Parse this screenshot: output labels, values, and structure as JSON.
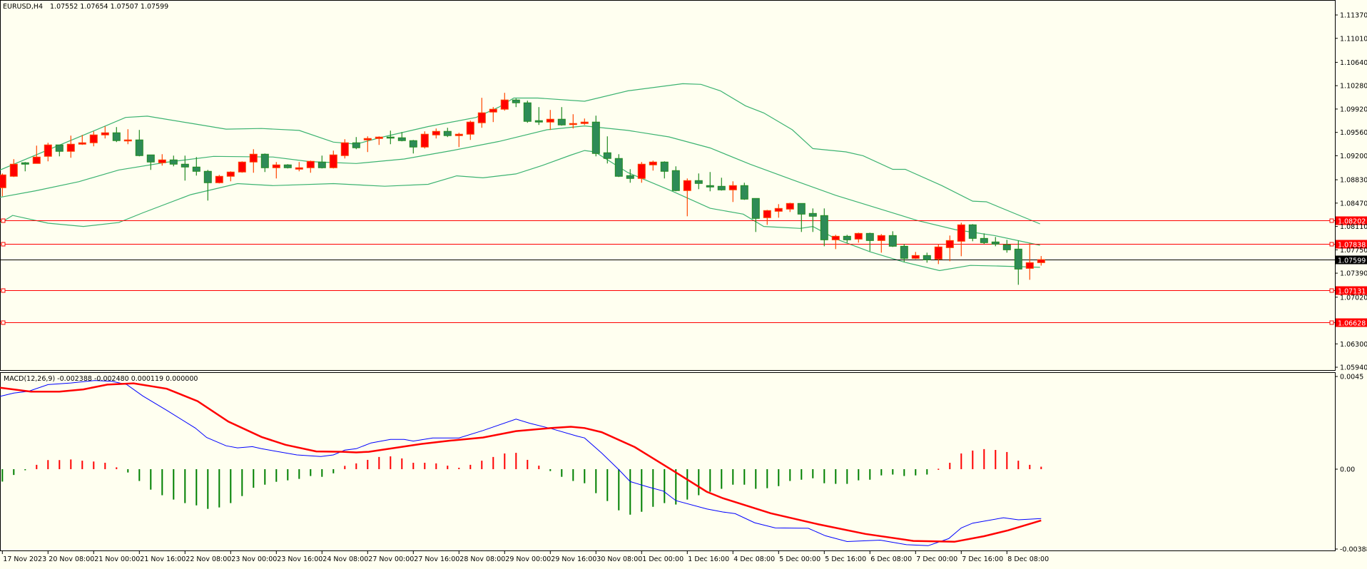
{
  "header": {
    "symbol_label": "EURUSD,H4",
    "ohlc_label": "1.07552 1.07654 1.07507 1.07599"
  },
  "macd": {
    "label": "MACD(12,26,9) -0.002388 -0.002480 0.000119 0.000000",
    "axis_labels": [
      {
        "text": "0.0045",
        "value": 0.0045
      },
      {
        "text": "0.00",
        "value": 0.0
      },
      {
        "text": "-0.003884",
        "value": -0.003884
      }
    ],
    "histogram": [
      -0.0006,
      -0.00028,
      -5e-05,
      0.00021,
      0.00044,
      0.00044,
      0.00047,
      0.00041,
      0.00037,
      0.00031,
      9e-05,
      -0.00016,
      -0.00057,
      -0.00099,
      -0.00126,
      -0.00147,
      -0.00164,
      -0.00175,
      -0.00192,
      -0.00185,
      -0.00164,
      -0.0013,
      -0.0009,
      -0.00075,
      -0.00061,
      -0.00054,
      -0.00047,
      -0.00033,
      -0.00037,
      -0.0002,
      0.00016,
      0.00028,
      0.00045,
      0.00059,
      0.00062,
      0.00052,
      0.00031,
      0.00031,
      0.00028,
      0.00017,
      7e-05,
      0.00021,
      0.00041,
      0.00059,
      0.00076,
      0.00079,
      0.00045,
      0.00017,
      -9e-05,
      -0.00037,
      -0.00057,
      -0.00068,
      -0.00116,
      -0.00154,
      -0.00199,
      -0.0022,
      -0.00206,
      -0.00182,
      -0.00164,
      -0.00171,
      -0.00147,
      -0.00126,
      -0.00109,
      -0.00095,
      -0.00075,
      -0.00075,
      -0.00095,
      -0.00092,
      -0.00082,
      -0.00057,
      -0.00051,
      -0.00044,
      -0.00068,
      -0.00071,
      -0.00071,
      -0.00054,
      -0.00051,
      -0.0003,
      -0.00026,
      -0.00033,
      -0.0003,
      -0.00026,
      2e-05,
      0.00031,
      0.00076,
      0.0009,
      0.00097,
      0.00093,
      0.00083,
      0.00041,
      0.00021,
      0.000119
    ],
    "main_line": [
      [
        -0.2,
        0.00352
      ],
      [
        1,
        0.00368
      ],
      [
        2.3,
        0.00377
      ],
      [
        4,
        0.00409
      ],
      [
        6,
        0.00417
      ],
      [
        8.1,
        0.00429
      ],
      [
        9.6,
        0.00425
      ],
      [
        10.9,
        0.00409
      ],
      [
        12.3,
        0.00354
      ],
      [
        14.4,
        0.00285
      ],
      [
        16.9,
        0.00199
      ],
      [
        17.9,
        0.00153
      ],
      [
        19.6,
        0.00113
      ],
      [
        20.6,
        0.00103
      ],
      [
        21.9,
        0.00109
      ],
      [
        22.7,
        0.00099
      ],
      [
        25.8,
        0.00069
      ],
      [
        27.9,
        0.00061
      ],
      [
        29,
        0.00069
      ],
      [
        30,
        0.00092
      ],
      [
        31,
        0.00099
      ],
      [
        32.3,
        0.00127
      ],
      [
        34,
        0.00144
      ],
      [
        35.2,
        0.00144
      ],
      [
        36,
        0.00136
      ],
      [
        37.7,
        0.00151
      ],
      [
        40,
        0.00151
      ],
      [
        42.1,
        0.00187
      ],
      [
        45,
        0.00242
      ],
      [
        46.2,
        0.00222
      ],
      [
        48.1,
        0.00196
      ],
      [
        50.4,
        0.00159
      ],
      [
        51,
        0.00151
      ],
      [
        52.5,
        0.00078
      ],
      [
        54,
        -2e-05
      ],
      [
        55,
        -0.0006
      ],
      [
        56.5,
        -0.00085
      ],
      [
        57.9,
        -0.00106
      ],
      [
        59,
        -0.00152
      ],
      [
        61.7,
        -0.00192
      ],
      [
        63.1,
        -0.00207
      ],
      [
        64.2,
        -0.00215
      ],
      [
        65.9,
        -0.00259
      ],
      [
        67.7,
        -0.00284
      ],
      [
        70.6,
        -0.00286
      ],
      [
        72.1,
        -0.00322
      ],
      [
        74,
        -0.0035
      ],
      [
        76.9,
        -0.00343
      ],
      [
        79.2,
        -0.00365
      ],
      [
        81.1,
        -0.0037
      ],
      [
        82.9,
        -0.00336
      ],
      [
        84,
        -0.00284
      ],
      [
        85,
        -0.00261
      ],
      [
        87.7,
        -0.00235
      ],
      [
        89,
        -0.00245
      ],
      [
        91,
        -0.002388
      ]
    ],
    "signal_line": [
      [
        -0.2,
        0.00394
      ],
      [
        2.5,
        0.00375
      ],
      [
        5,
        0.00375
      ],
      [
        7.1,
        0.00386
      ],
      [
        9.2,
        0.00409
      ],
      [
        11.5,
        0.00415
      ],
      [
        14.4,
        0.00389
      ],
      [
        17.1,
        0.00329
      ],
      [
        19.8,
        0.0023
      ],
      [
        22.7,
        0.00156
      ],
      [
        24.8,
        0.00118
      ],
      [
        27.5,
        0.00086
      ],
      [
        29.8,
        0.00084
      ],
      [
        31,
        0.00081
      ],
      [
        32.1,
        0.00084
      ],
      [
        36.7,
        0.00122
      ],
      [
        39.2,
        0.00138
      ],
      [
        42.1,
        0.00153
      ],
      [
        45,
        0.00184
      ],
      [
        48.1,
        0.00199
      ],
      [
        49.8,
        0.00205
      ],
      [
        51,
        0.00199
      ],
      [
        52.5,
        0.00179
      ],
      [
        55.4,
        0.00107
      ],
      [
        58.6,
        -2e-05
      ],
      [
        61.7,
        -0.00109
      ],
      [
        63.1,
        -0.0014
      ],
      [
        67.3,
        -0.00213
      ],
      [
        71.5,
        -0.00267
      ],
      [
        75.6,
        -0.00313
      ],
      [
        79.8,
        -0.00347
      ],
      [
        83.4,
        -0.00351
      ],
      [
        86,
        -0.00324
      ],
      [
        88.1,
        -0.00296
      ],
      [
        91,
        -0.00248
      ]
    ]
  },
  "price_axis": [
    "1.11370",
    "1.11010",
    "1.10640",
    "1.10280",
    "1.09920",
    "1.09560",
    "1.09200",
    "1.08830",
    "1.08470",
    "1.08110",
    "1.07750",
    "1.07390",
    "1.07020",
    "1.06300",
    "1.05940"
  ],
  "levels": [
    {
      "text": "1.08202",
      "price": 1.08202,
      "kind": "support-resistance"
    },
    {
      "text": "1.07838",
      "price": 1.07838,
      "kind": "support-resistance"
    },
    {
      "text": "1.07131",
      "price": 1.07131,
      "kind": "support-resistance"
    },
    {
      "text": "1.06628",
      "price": 1.06628,
      "kind": "support-resistance"
    }
  ],
  "bid": {
    "text": "1.07599",
    "price": 1.07599
  },
  "time_axis": [
    "17 Nov 2023",
    "20 Nov 08:00",
    "21 Nov 00:00",
    "21 Nov 16:00",
    "22 Nov 08:00",
    "23 Nov 00:00",
    "23 Nov 16:00",
    "24 Nov 08:00",
    "27 Nov 00:00",
    "27 Nov 16:00",
    "28 Nov 08:00",
    "29 Nov 00:00",
    "29 Nov 16:00",
    "30 Nov 08:00",
    "1 Dec 00:00",
    "1 Dec 16:00",
    "4 Dec 08:00",
    "5 Dec 00:00",
    "5 Dec 16:00",
    "6 Dec 08:00",
    "7 Dec 00:00",
    "7 Dec 16:00",
    "8 Dec 08:00"
  ],
  "colors": {
    "background": "#fffff0",
    "bull_fill": "#ff0000",
    "bull_edge": "#ff4500",
    "bear_fill": "#2e8b57",
    "bear_edge": "#228b22",
    "bands": "#3cb371",
    "level": "#ff0000",
    "bid": "#000000",
    "macd_main": "#0000ff",
    "macd_signal": "#ff0000",
    "hist_pos": "#ff0000",
    "hist_neg": "#008000"
  },
  "candles": [
    [
      1.08707,
      1.08927,
      1.08575,
      1.08905
    ],
    [
      1.08883,
      1.09147,
      1.08872,
      1.0907
    ],
    [
      1.09092,
      1.09103,
      1.0896,
      1.0907
    ],
    [
      1.09081,
      1.09356,
      1.09081,
      1.0918
    ],
    [
      1.09191,
      1.094,
      1.09114,
      1.09367
    ],
    [
      1.09367,
      1.09367,
      1.09191,
      1.09268
    ],
    [
      1.09268,
      1.0951,
      1.09169,
      1.09378
    ],
    [
      1.09378,
      1.09521,
      1.09367,
      1.094
    ],
    [
      1.094,
      1.09576,
      1.09345,
      1.09521
    ],
    [
      1.09521,
      1.09653,
      1.09466,
      1.09554
    ],
    [
      1.09554,
      1.09642,
      1.09411,
      1.09433
    ],
    [
      1.09433,
      1.09609,
      1.09378,
      1.09444
    ],
    [
      1.09444,
      1.09598,
      1.09191,
      1.09202
    ],
    [
      1.09213,
      1.09213,
      1.08982,
      1.09103
    ],
    [
      1.09092,
      1.09224,
      1.09048,
      1.09136
    ],
    [
      1.09136,
      1.09202,
      1.09037,
      1.0907
    ],
    [
      1.0907,
      1.09202,
      1.08817,
      1.09026
    ],
    [
      1.09026,
      1.0918,
      1.08894,
      1.0896
    ],
    [
      1.0896,
      1.08982,
      1.08509,
      1.08784
    ],
    [
      1.08784,
      1.08905,
      1.08773,
      1.08883
    ],
    [
      1.08883,
      1.0896,
      1.08806,
      1.08949
    ],
    [
      1.08949,
      1.09114,
      1.08938,
      1.09103
    ],
    [
      1.09103,
      1.09301,
      1.08938,
      1.09224
    ],
    [
      1.09224,
      1.09235,
      1.08949,
      1.09015
    ],
    [
      1.09015,
      1.09103,
      1.0885,
      1.09059
    ],
    [
      1.09059,
      1.0907,
      1.09004,
      1.09015
    ],
    [
      1.08993,
      1.09103,
      1.0896,
      1.09015
    ],
    [
      1.09015,
      1.09125,
      1.08938,
      1.09114
    ],
    [
      1.09103,
      1.09202,
      1.09004,
      1.09015
    ],
    [
      1.09015,
      1.09279,
      1.09004,
      1.09213
    ],
    [
      1.09202,
      1.09455,
      1.09158,
      1.094
    ],
    [
      1.094,
      1.09488,
      1.09301,
      1.09323
    ],
    [
      1.09444,
      1.09499,
      1.09257,
      1.09466
    ],
    [
      1.09466,
      1.09499,
      1.09367,
      1.09488
    ],
    [
      1.09488,
      1.09587,
      1.09378,
      1.09477
    ],
    [
      1.09477,
      1.09565,
      1.09422,
      1.09433
    ],
    [
      1.09433,
      1.09444,
      1.09235,
      1.09334
    ],
    [
      1.09334,
      1.09576,
      1.09312,
      1.09532
    ],
    [
      1.09521,
      1.0962,
      1.09466,
      1.09576
    ],
    [
      1.09576,
      1.09631,
      1.09488,
      1.0951
    ],
    [
      1.0951,
      1.09554,
      1.09334,
      1.09532
    ],
    [
      1.09532,
      1.09741,
      1.09444,
      1.09719
    ],
    [
      1.09708,
      1.10093,
      1.09631,
      1.09862
    ],
    [
      1.09873,
      1.0995,
      1.09719,
      1.09917
    ],
    [
      1.09917,
      1.1017,
      1.09895,
      1.1006
    ],
    [
      1.1006,
      1.10082,
      1.0995,
      1.10016
    ],
    [
      1.10016,
      1.10049,
      1.09708,
      1.0973
    ],
    [
      1.09741,
      1.0995,
      1.09675,
      1.09719
    ],
    [
      1.09719,
      1.09906,
      1.09598,
      1.09763
    ],
    [
      1.09763,
      1.0995,
      1.09664,
      1.09675
    ],
    [
      1.09686,
      1.0984,
      1.0962,
      1.09697
    ],
    [
      1.09697,
      1.09774,
      1.09675,
      1.09719
    ],
    [
      1.09719,
      1.09818,
      1.09191,
      1.09235
    ],
    [
      1.09246,
      1.09499,
      1.09081,
      1.09158
    ],
    [
      1.09158,
      1.09224,
      1.08872,
      1.08883
    ],
    [
      1.08894,
      1.08993,
      1.08784,
      1.0885
    ],
    [
      1.0885,
      1.09103,
      1.08784,
      1.0907
    ],
    [
      1.09059,
      1.09125,
      1.08971,
      1.09103
    ],
    [
      1.09103,
      1.09114,
      1.0885,
      1.0896
    ],
    [
      1.08971,
      1.09037,
      1.08652,
      1.08663
    ],
    [
      1.08663,
      1.0885,
      1.08267,
      1.08817
    ],
    [
      1.08817,
      1.08927,
      1.08685,
      1.08773
    ],
    [
      1.0874,
      1.08949,
      1.08652,
      1.08718
    ],
    [
      1.08729,
      1.08861,
      1.08663,
      1.08674
    ],
    [
      1.08674,
      1.08806,
      1.08487,
      1.0874
    ],
    [
      1.0874,
      1.08784,
      1.0852,
      1.08531
    ],
    [
      1.08542,
      1.08542,
      1.08025,
      1.08234
    ],
    [
      1.08245,
      1.08366,
      1.08135,
      1.08355
    ],
    [
      1.08344,
      1.08454,
      1.08245,
      1.08388
    ],
    [
      1.08377,
      1.08476,
      1.08333,
      1.08465
    ],
    [
      1.08465,
      1.08465,
      1.08025,
      1.083
    ],
    [
      1.08311,
      1.08388,
      1.08025,
      1.08267
    ],
    [
      1.08278,
      1.08388,
      1.07805,
      1.07904
    ],
    [
      1.07904,
      1.07981,
      1.07761,
      1.07959
    ],
    [
      1.07959,
      1.07981,
      1.0786,
      1.07904
    ],
    [
      1.07915,
      1.08014,
      1.0786,
      1.08003
    ],
    [
      1.08003,
      1.08014,
      1.07728,
      1.07893
    ],
    [
      1.07893,
      1.07992,
      1.07706,
      1.0797
    ],
    [
      1.0797,
      1.08036,
      1.07794,
      1.07805
    ],
    [
      1.07805,
      1.07838,
      1.07563,
      1.07618
    ],
    [
      1.07618,
      1.07717,
      1.07607,
      1.07662
    ],
    [
      1.07662,
      1.07706,
      1.07552,
      1.07596
    ],
    [
      1.07607,
      1.07838,
      1.0753,
      1.07794
    ],
    [
      1.07783,
      1.0797,
      1.07574,
      1.07893
    ],
    [
      1.07882,
      1.08168,
      1.07651,
      1.08135
    ],
    [
      1.08135,
      1.08146,
      1.07882,
      1.07926
    ],
    [
      1.07926,
      1.08003,
      1.07838,
      1.0786
    ],
    [
      1.07871,
      1.07948,
      1.07805,
      1.07838
    ],
    [
      1.07827,
      1.07904,
      1.07706,
      1.0775
    ],
    [
      1.07761,
      1.07893,
      1.07211,
      1.07453
    ],
    [
      1.07464,
      1.07849,
      1.07288,
      1.07552
    ],
    [
      1.07552,
      1.07654,
      1.07507,
      1.07599
    ]
  ],
  "bollinger": {
    "upper": [
      [
        -0.2,
        1.0898
      ],
      [
        4,
        1.0929
      ],
      [
        8.1,
        1.0959
      ],
      [
        10.8,
        1.0979
      ],
      [
        12.7,
        1.0981
      ],
      [
        16.5,
        1.097
      ],
      [
        19.6,
        1.0961
      ],
      [
        22.7,
        1.0962
      ],
      [
        26,
        1.0959
      ],
      [
        29,
        1.0941
      ],
      [
        31,
        1.0938
      ],
      [
        33.1,
        1.0948
      ],
      [
        37.3,
        1.0965
      ],
      [
        41.5,
        1.0979
      ],
      [
        43.5,
        1.0995
      ],
      [
        44.8,
        1.1009
      ],
      [
        46.9,
        1.1009
      ],
      [
        51,
        1.1004
      ],
      [
        54.8,
        1.102
      ],
      [
        59.6,
        1.1031
      ],
      [
        61.2,
        1.103
      ],
      [
        62.9,
        1.102
      ],
      [
        65.1,
        1.0997
      ],
      [
        66.7,
        1.0986
      ],
      [
        69.2,
        1.096
      ],
      [
        71,
        1.0931
      ],
      [
        73.9,
        1.0926
      ],
      [
        75.4,
        1.092
      ],
      [
        78,
        1.0899
      ],
      [
        79.1,
        1.0899
      ],
      [
        82.3,
        1.0874
      ],
      [
        85,
        1.085
      ],
      [
        86.2,
        1.0849
      ],
      [
        90.9,
        1.0815
      ]
    ],
    "middle": [
      [
        -0.2,
        1.0856
      ],
      [
        2.9,
        1.0866
      ],
      [
        6.7,
        1.088
      ],
      [
        10.2,
        1.0898
      ],
      [
        14.4,
        1.091
      ],
      [
        18.5,
        1.0919
      ],
      [
        23.7,
        1.0918
      ],
      [
        26.9,
        1.0911
      ],
      [
        31,
        1.0908
      ],
      [
        35.2,
        1.0915
      ],
      [
        39.4,
        1.0928
      ],
      [
        43.5,
        1.0942
      ],
      [
        47.7,
        1.096
      ],
      [
        51,
        1.0966
      ],
      [
        54.8,
        1.0959
      ],
      [
        58.4,
        1.0949
      ],
      [
        62,
        1.0932
      ],
      [
        65.5,
        1.0907
      ],
      [
        69.2,
        1.0883
      ],
      [
        73,
        1.0859
      ],
      [
        77.8,
        1.0833
      ],
      [
        80.2,
        1.082
      ],
      [
        83.5,
        1.0806
      ],
      [
        86.9,
        1.0797
      ],
      [
        90.9,
        1.0782
      ]
    ],
    "lower": [
      [
        -0.2,
        1.0816
      ],
      [
        0.9,
        1.0828
      ],
      [
        4,
        1.0816
      ],
      [
        7.1,
        1.0811
      ],
      [
        10.2,
        1.0817
      ],
      [
        12.3,
        1.0832
      ],
      [
        16.5,
        1.086
      ],
      [
        20.6,
        1.0877
      ],
      [
        23.7,
        1.0874
      ],
      [
        29,
        1.0877
      ],
      [
        33.5,
        1.0873
      ],
      [
        37.3,
        1.0876
      ],
      [
        39.8,
        1.0889
      ],
      [
        42.1,
        1.0886
      ],
      [
        45,
        1.0892
      ],
      [
        47.3,
        1.0905
      ],
      [
        49.8,
        1.0921
      ],
      [
        51,
        1.0928
      ],
      [
        51.9,
        1.0926
      ],
      [
        54.8,
        1.0894
      ],
      [
        58.6,
        1.0866
      ],
      [
        62,
        1.0839
      ],
      [
        64.9,
        1.083
      ],
      [
        66.7,
        1.0811
      ],
      [
        69.9,
        1.0808
      ],
      [
        71,
        1.0811
      ],
      [
        73,
        1.0792
      ],
      [
        76,
        1.0772
      ],
      [
        79,
        1.0756
      ],
      [
        82.1,
        1.0743
      ],
      [
        84.8,
        1.0751
      ],
      [
        87.3,
        1.075
      ],
      [
        90.9,
        1.0748
      ]
    ]
  }
}
